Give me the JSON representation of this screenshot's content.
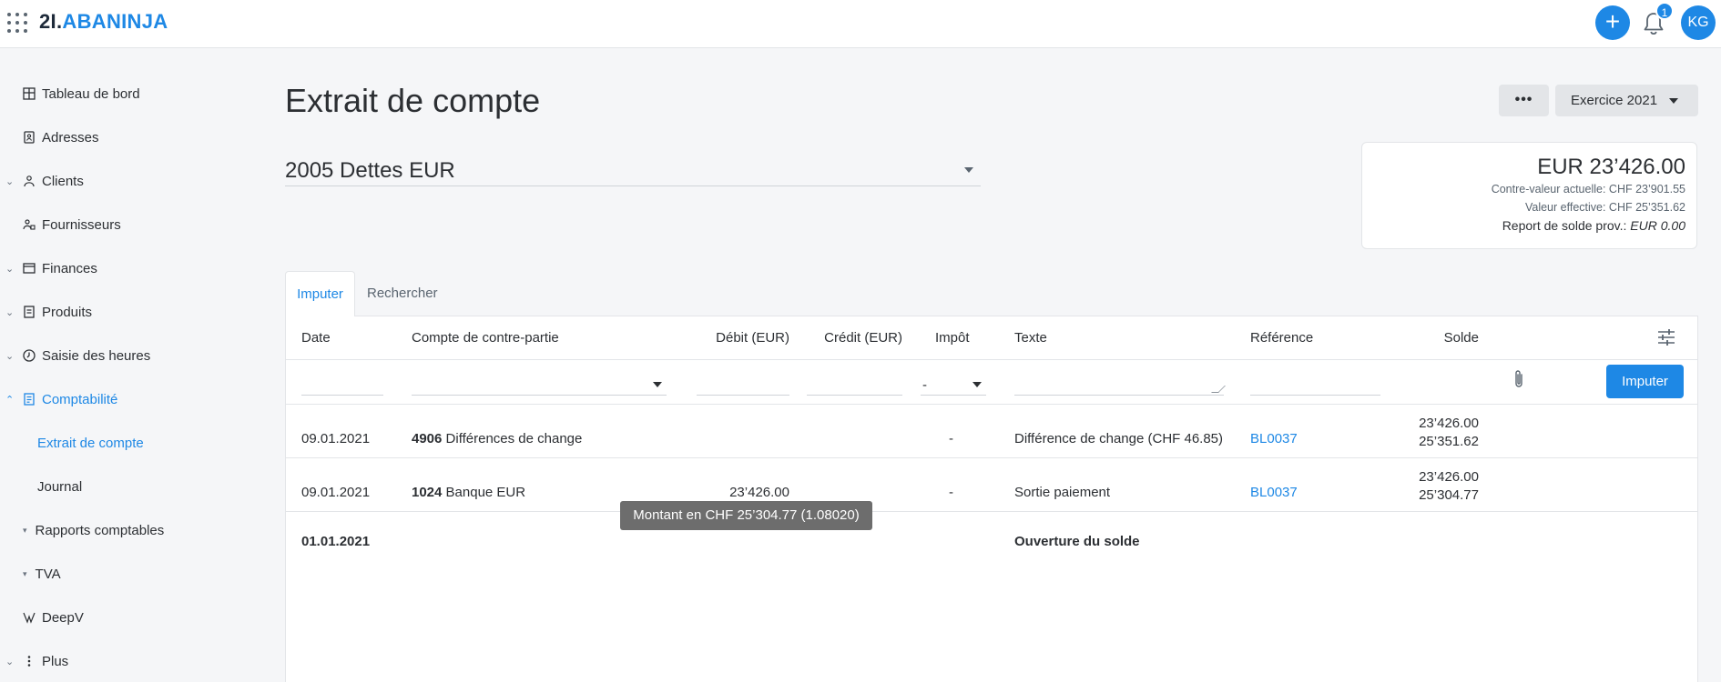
{
  "header": {
    "logo_num": "2",
    "logo_dot": "I.",
    "logo_name": "ABANINJA",
    "notification_count": "1",
    "avatar_initials": "KG"
  },
  "sidebar": {
    "items": [
      {
        "label": "Tableau de bord",
        "icon": "dashboard-icon"
      },
      {
        "label": "Adresses",
        "icon": "address-book-icon"
      },
      {
        "label": "Clients",
        "icon": "clients-icon"
      },
      {
        "label": "Fournisseurs",
        "icon": "suppliers-icon"
      },
      {
        "label": "Finances",
        "icon": "finances-icon"
      },
      {
        "label": "Produits",
        "icon": "products-icon"
      },
      {
        "label": "Saisie des heures",
        "icon": "clock-icon"
      },
      {
        "label": "Comptabilité",
        "icon": "accounting-icon"
      },
      {
        "label": "Extrait de compte"
      },
      {
        "label": "Journal"
      },
      {
        "label": "Rapports comptables"
      },
      {
        "label": "TVA"
      },
      {
        "label": "DeepV",
        "icon": "deepv-icon"
      },
      {
        "label": "Plus",
        "icon": "more-vertical-icon"
      }
    ]
  },
  "page": {
    "title": "Extrait de compte",
    "more_label": "•••",
    "year_label": "Exercice 2021",
    "account": "2005 Dettes EUR"
  },
  "balance": {
    "main": "EUR 23’426.00",
    "current_value": "Contre-valeur actuelle: CHF 23’901.55",
    "effective_value": "Valeur effective: CHF 25’351.62",
    "carry_label": "Report de solde prov.:",
    "carry_value": "EUR 0.00"
  },
  "tabs": [
    "Imputer",
    "Rechercher"
  ],
  "table": {
    "headers": [
      "Date",
      "Compte de contre-partie",
      "Débit (EUR)",
      "Crédit (EUR)",
      "Impôt",
      "Texte",
      "Référence",
      "Solde"
    ],
    "input_row": {
      "tax_value": "-",
      "button": "Imputer"
    },
    "rows": [
      {
        "date": "09.01.2021",
        "account_no": "4906",
        "account_name": "Différences de change",
        "debit": "",
        "credit": "",
        "tax": "-",
        "text": "Différence de change (CHF 46.85)",
        "reference": "BL0037",
        "balance1": "23’426.00",
        "balance2": "25’351.62"
      },
      {
        "date": "09.01.2021",
        "account_no": "1024",
        "account_name": "Banque EUR",
        "debit": "23’426.00",
        "credit": "",
        "tax": "-",
        "text": "Sortie paiement",
        "reference": "BL0037",
        "balance1": "23’426.00",
        "balance2": "25’304.77"
      }
    ],
    "opening": {
      "date": "01.01.2021",
      "text": "Ouverture du solde"
    }
  },
  "tooltip": "Montant en CHF 25’304.77 (1.08020)",
  "colors": {
    "accent": "#1e88e5",
    "tooltip_bg": "#6d6d6d"
  }
}
